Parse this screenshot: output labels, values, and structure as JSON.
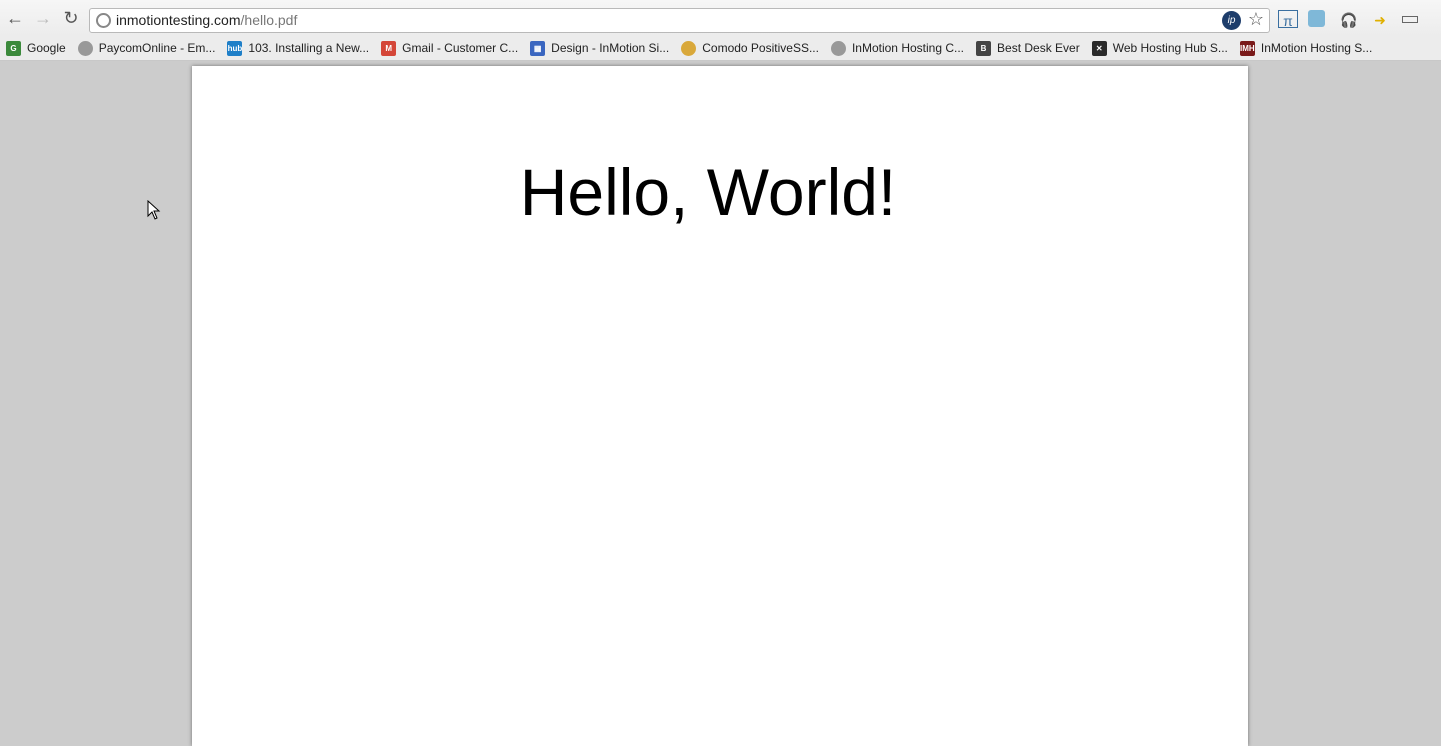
{
  "browser": {
    "url_host": "inmotiontesting.com",
    "url_path": "/hello.pdf",
    "nav": {
      "back": "←",
      "forward": "→",
      "reload": "↻"
    },
    "extensions": [
      "ip-icon",
      "star-icon",
      "pi-icon",
      "owl-icon",
      "headphones-icon",
      "phone-arrow-icon",
      "minimize-icon"
    ]
  },
  "bookmarks": [
    {
      "label": "Google",
      "icon": "G",
      "color": "#3c8a3c"
    },
    {
      "label": "PaycomOnline - Em...",
      "icon": "",
      "color": "#999999"
    },
    {
      "label": "103. Installing a New...",
      "icon": "hub",
      "color": "#1e7fc8"
    },
    {
      "label": "Gmail - Customer C...",
      "icon": "M",
      "color": "#d44638"
    },
    {
      "label": "Design - InMotion Si...",
      "icon": "▦",
      "color": "#3a66c0"
    },
    {
      "label": "Comodo PositiveSS...",
      "icon": "",
      "color": "#d9a83a"
    },
    {
      "label": "InMotion Hosting C...",
      "icon": "",
      "color": "#999999"
    },
    {
      "label": "Best Desk Ever",
      "icon": "B",
      "color": "#444444"
    },
    {
      "label": "Web Hosting Hub S...",
      "icon": "✕",
      "color": "#2a2a2a"
    },
    {
      "label": "InMotion Hosting S...",
      "icon": "IMH",
      "color": "#7a1a1a"
    }
  ],
  "document": {
    "text": "Hello, World!"
  }
}
